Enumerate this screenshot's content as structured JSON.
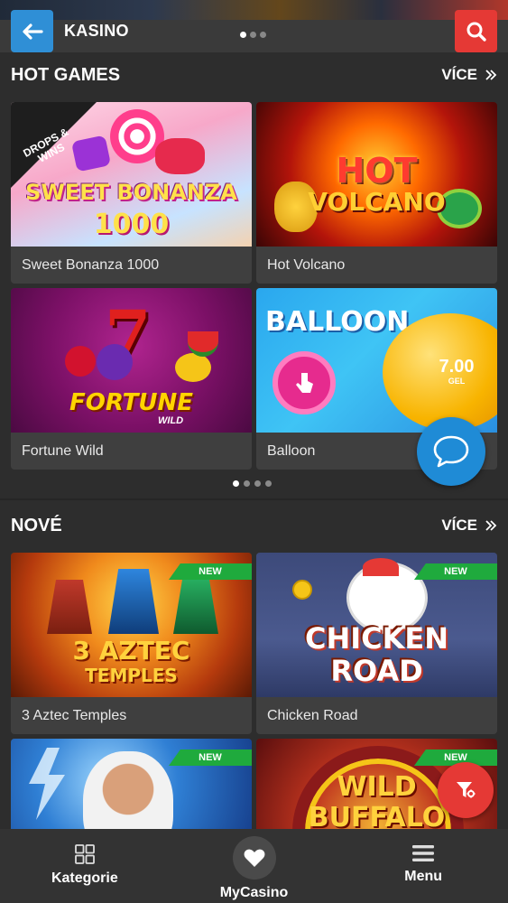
{
  "header": {
    "title": "KASINO",
    "back_icon": "arrow-left-icon",
    "search_icon": "search-icon",
    "banner_dots": 3,
    "banner_active_dot": 1,
    "colors": {
      "back": "#2f8fd6",
      "search": "#e53935"
    }
  },
  "hot_games": {
    "title": "HOT GAMES",
    "more_label": "VÍCE",
    "games": [
      {
        "name": "Sweet Bonanza 1000",
        "logo_line1": "SWEET BONANZA",
        "logo_line2": "1000",
        "corner_label": "DROPS & WINS"
      },
      {
        "name": "Hot Volcano",
        "logo_line1": "HOT",
        "logo_line2": "VOLCANO"
      },
      {
        "name": "Fortune Wild",
        "logo_line1": "FORTUNE",
        "logo_line2": "WILD"
      },
      {
        "name": "Balloon",
        "logo_line1": "BALLOON",
        "multiplier": "7.00",
        "currency": "GEL"
      }
    ],
    "pager_dots": 4,
    "pager_active": 1
  },
  "new_games": {
    "title": "NOVÉ",
    "more_label": "VÍCE",
    "badge": "NEW",
    "games": [
      {
        "name": "3 Aztec Temples",
        "logo_line1": "3 AZTEC",
        "logo_line2": "TEMPLES"
      },
      {
        "name": "Chicken Road",
        "logo_line1": "CHICKEN",
        "logo_line2": "ROAD"
      },
      {
        "name": "",
        "logo_line1": ""
      },
      {
        "name": "",
        "logo_line1": "WILD",
        "logo_line2": "BUFFALO"
      }
    ]
  },
  "fabs": {
    "chat_icon": "chat-bubble-icon",
    "filter_icon": "filter-icon"
  },
  "bottom_nav": {
    "items": [
      {
        "label": "Kategorie",
        "icon": "grid-icon"
      },
      {
        "label": "MyCasino",
        "icon": "heart-icon"
      },
      {
        "label": "Menu",
        "icon": "hamburger-menu-icon"
      }
    ]
  }
}
